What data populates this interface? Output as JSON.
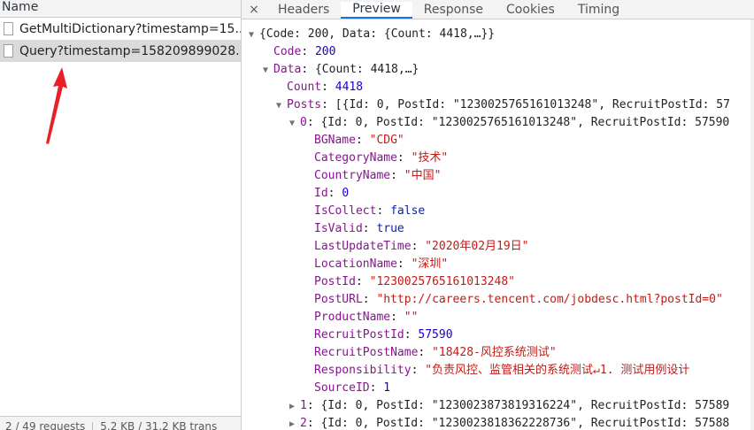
{
  "network": {
    "column_header": "Name",
    "requests": [
      {
        "name": "GetMultiDictionary?timestamp=15..."
      },
      {
        "name": "Query?timestamp=158209899028..."
      }
    ],
    "status_requests": "2 / 49 requests",
    "status_transfer": "5.2 KB / 31.2 KB trans"
  },
  "details": {
    "close_glyph": "×",
    "tabs": [
      "Headers",
      "Preview",
      "Response",
      "Cookies",
      "Timing"
    ],
    "active_tab": "Preview"
  },
  "preview": {
    "root_summary": "{Code: 200, Data: {Count: 4418,…}}",
    "code": {
      "key": "Code",
      "value": "200"
    },
    "data": {
      "key": "Data",
      "summary": "{Count: 4418,…}"
    },
    "count": {
      "key": "Count",
      "value": "4418"
    },
    "posts": {
      "key": "Posts",
      "summary": "[{Id: 0, PostId: \"1230025765161013248\", RecruitPostId: 57"
    },
    "item0": {
      "key": "0",
      "summary": "{Id: 0, PostId: \"1230025765161013248\", RecruitPostId: 57590"
    },
    "fields": [
      {
        "key": "BGName",
        "value": "\"CDG\"",
        "type": "s"
      },
      {
        "key": "CategoryName",
        "value": "\"技术\"",
        "type": "s"
      },
      {
        "key": "CountryName",
        "value": "\"中国\"",
        "type": "s"
      },
      {
        "key": "Id",
        "value": "0",
        "type": "n"
      },
      {
        "key": "IsCollect",
        "value": "false",
        "type": "kw"
      },
      {
        "key": "IsValid",
        "value": "true",
        "type": "kw"
      },
      {
        "key": "LastUpdateTime",
        "value": "\"2020年02月19日\"",
        "type": "s"
      },
      {
        "key": "LocationName",
        "value": "\"深圳\"",
        "type": "s"
      },
      {
        "key": "PostId",
        "value": "\"1230025765161013248\"",
        "type": "s"
      },
      {
        "key": "PostURL",
        "value": "\"http://careers.tencent.com/jobdesc.html?postId=0\"",
        "type": "s"
      },
      {
        "key": "ProductName",
        "value": "\"\"",
        "type": "s"
      },
      {
        "key": "RecruitPostId",
        "value": "57590",
        "type": "n"
      },
      {
        "key": "RecruitPostName",
        "value": "\"18428-风控系统测试\"",
        "type": "s"
      },
      {
        "key": "Responsibility",
        "value": "\"负责风控、监管相关的系统测试↵1. 测试用例设计",
        "type": "s"
      },
      {
        "key": "SourceID",
        "value": "1",
        "type": "n"
      }
    ],
    "item1": {
      "key": "1",
      "summary": "{Id: 0, PostId: \"1230023873819316224\", RecruitPostId: 57589"
    },
    "item2": {
      "key": "2",
      "summary": "{Id: 0, PostId: \"1230023818362228736\", RecruitPostId: 57588"
    }
  },
  "colors": {
    "accent": "#1a73e8",
    "key": "#881391",
    "string": "#c41a16",
    "number": "#1c00cf",
    "annotation": "#ea2027"
  }
}
